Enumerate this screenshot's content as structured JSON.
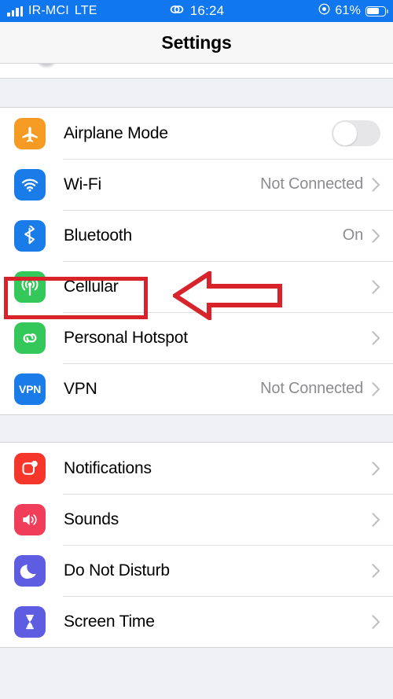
{
  "status_bar": {
    "signal_icon": "signal-bars-icon",
    "carrier": "IR-MCI",
    "network_type": "LTE",
    "link_icon": "chain-link-icon",
    "time": "16:24",
    "location_icon": "location-services-icon",
    "battery_percent": "61%",
    "battery_level": 61,
    "background_color": "#1177ee"
  },
  "navbar": {
    "title": "Settings"
  },
  "groups": [
    {
      "rows": [
        {
          "label": "Airplane Mode",
          "icon": "airplane-icon",
          "icon_color": "#f59a23",
          "accessory": "toggle",
          "toggle_on": false,
          "value": ""
        },
        {
          "label": "Wi-Fi",
          "icon": "wifi-icon",
          "icon_color": "#1a7ce8",
          "accessory": "chevron",
          "value": "Not Connected"
        },
        {
          "label": "Bluetooth",
          "icon": "bluetooth-icon",
          "icon_color": "#1a7ce8",
          "accessory": "chevron",
          "value": "On"
        },
        {
          "label": "Cellular",
          "icon": "cellular-antenna-icon",
          "icon_color": "#34c759",
          "accessory": "chevron",
          "value": ""
        },
        {
          "label": "Personal Hotspot",
          "icon": "hotspot-link-icon",
          "icon_color": "#34c759",
          "accessory": "chevron",
          "value": ""
        },
        {
          "label": "VPN",
          "icon": "vpn-icon",
          "icon_color": "#1a7ce8",
          "icon_text": "VPN",
          "accessory": "chevron",
          "value": "Not Connected"
        }
      ]
    },
    {
      "rows": [
        {
          "label": "Notifications",
          "icon": "notifications-badge-icon",
          "icon_color": "#f5372b",
          "accessory": "chevron",
          "value": ""
        },
        {
          "label": "Sounds",
          "icon": "speaker-volume-icon",
          "icon_color": "#f03e5a",
          "accessory": "chevron",
          "value": ""
        },
        {
          "label": "Do Not Disturb",
          "icon": "moon-icon",
          "icon_color": "#5e5ce0",
          "accessory": "chevron",
          "value": ""
        },
        {
          "label": "Screen Time",
          "icon": "hourglass-icon",
          "icon_color": "#5e5ce0",
          "accessory": "chevron",
          "value": ""
        }
      ]
    }
  ],
  "annotations": {
    "highlight_target": "Cellular",
    "highlight_color": "#d9232b",
    "arrow_icon": "left-arrow-annotation",
    "arrow_color": "#d9232b"
  }
}
